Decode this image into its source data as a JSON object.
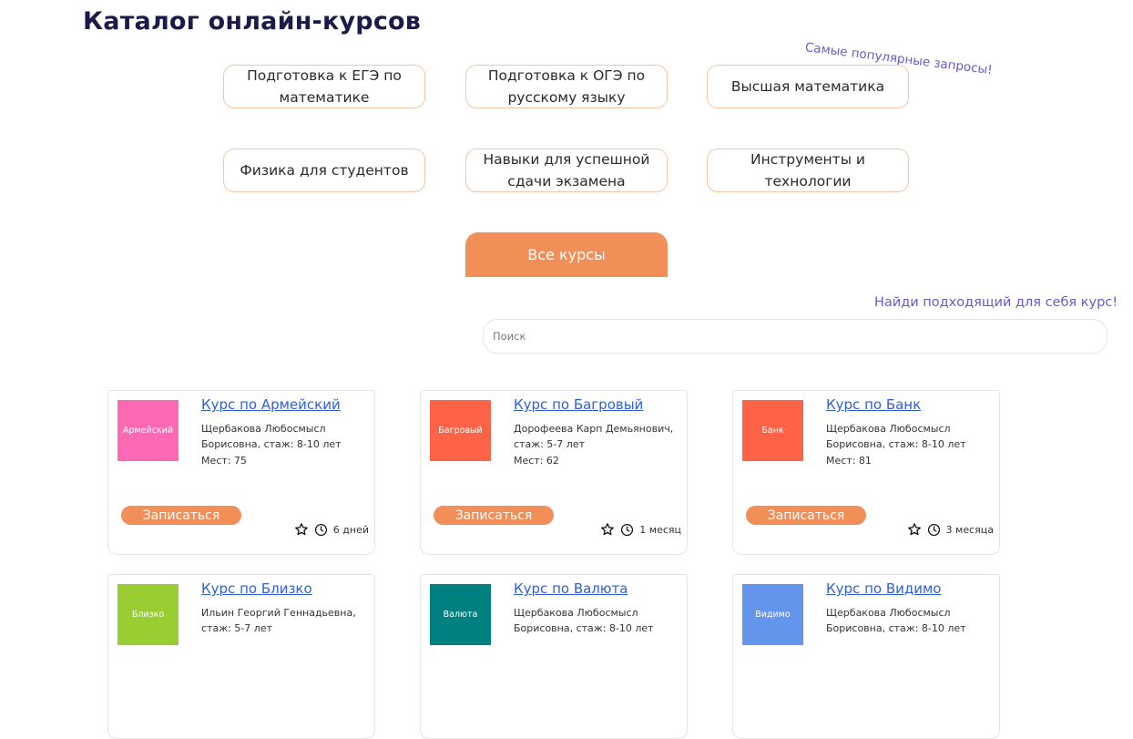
{
  "header": {
    "title": "Каталог онлайн-курсов",
    "popular_note": "Самые популярные запросы!"
  },
  "popular_chips": [
    {
      "line1": "Подготовка к ЕГЭ по",
      "line2": "математике"
    },
    {
      "line1": "Подготовка к ОГЭ по",
      "line2": "русскому языку"
    },
    {
      "line1": "Высшая математика",
      "line2": ""
    },
    {
      "line1": "Физика для студентов",
      "line2": ""
    },
    {
      "line1": "Навыки для успешной",
      "line2": "сдачи экзамена"
    },
    {
      "line1": "Инструменты и",
      "line2": "технологии"
    }
  ],
  "all_courses_label": "Все курсы",
  "find_note": "Найди подходящий для себя курс!",
  "search": {
    "placeholder": "Поиск",
    "value": ""
  },
  "icons": {
    "favorite": "star-outline-icon",
    "duration": "clock-icon"
  },
  "colors": {
    "accent": "#f28e57",
    "chip_border": "#f2c6a6",
    "note": "#6a5acd",
    "link": "#2e5fd8",
    "title": "#1b1b4b"
  },
  "courses": [
    {
      "thumb_label": "Армейский",
      "thumb_color": "#ff69b4",
      "title": "Курс по Армейский",
      "teacher_line1": "Щербакова Любосмысл",
      "teacher_line2": "Борисовна, стаж: 8-10 лет",
      "seats": "Мест: 75",
      "enroll_label": "Записаться",
      "duration": "6 дней"
    },
    {
      "thumb_label": "Багровый",
      "thumb_color": "#ff6347",
      "title": "Курс по Багровый",
      "teacher_line1": "Дорофеева Карп Демьянович,",
      "teacher_line2": "стаж: 5-7 лет",
      "seats": "Мест: 62",
      "enroll_label": "Записаться",
      "duration": "1 месяц"
    },
    {
      "thumb_label": "Банк",
      "thumb_color": "#ff6347",
      "title": "Курс по Банк",
      "teacher_line1": "Щербакова Любосмысл",
      "teacher_line2": "Борисовна, стаж: 8-10 лет",
      "seats": "Мест: 81",
      "enroll_label": "Записаться",
      "duration": "3 месяца"
    },
    {
      "thumb_label": "Близко",
      "thumb_color": "#9acd32",
      "title": "Курс по Близко",
      "teacher_line1": "Ильин Георгий Геннадьевна,",
      "teacher_line2": "стаж: 5-7 лет",
      "seats": "",
      "enroll_label": "",
      "duration": ""
    },
    {
      "thumb_label": "Валюта",
      "thumb_color": "#008080",
      "title": "Курс по Валюта",
      "teacher_line1": "Щербакова Любосмысл",
      "teacher_line2": "Борисовна, стаж: 8-10 лет",
      "seats": "",
      "enroll_label": "",
      "duration": ""
    },
    {
      "thumb_label": "Видимо",
      "thumb_color": "#6495ed",
      "title": "Курс по Видимо",
      "teacher_line1": "Щербакова Любосмысл",
      "teacher_line2": "Борисовна, стаж: 8-10 лет",
      "seats": "",
      "enroll_label": "",
      "duration": ""
    }
  ]
}
